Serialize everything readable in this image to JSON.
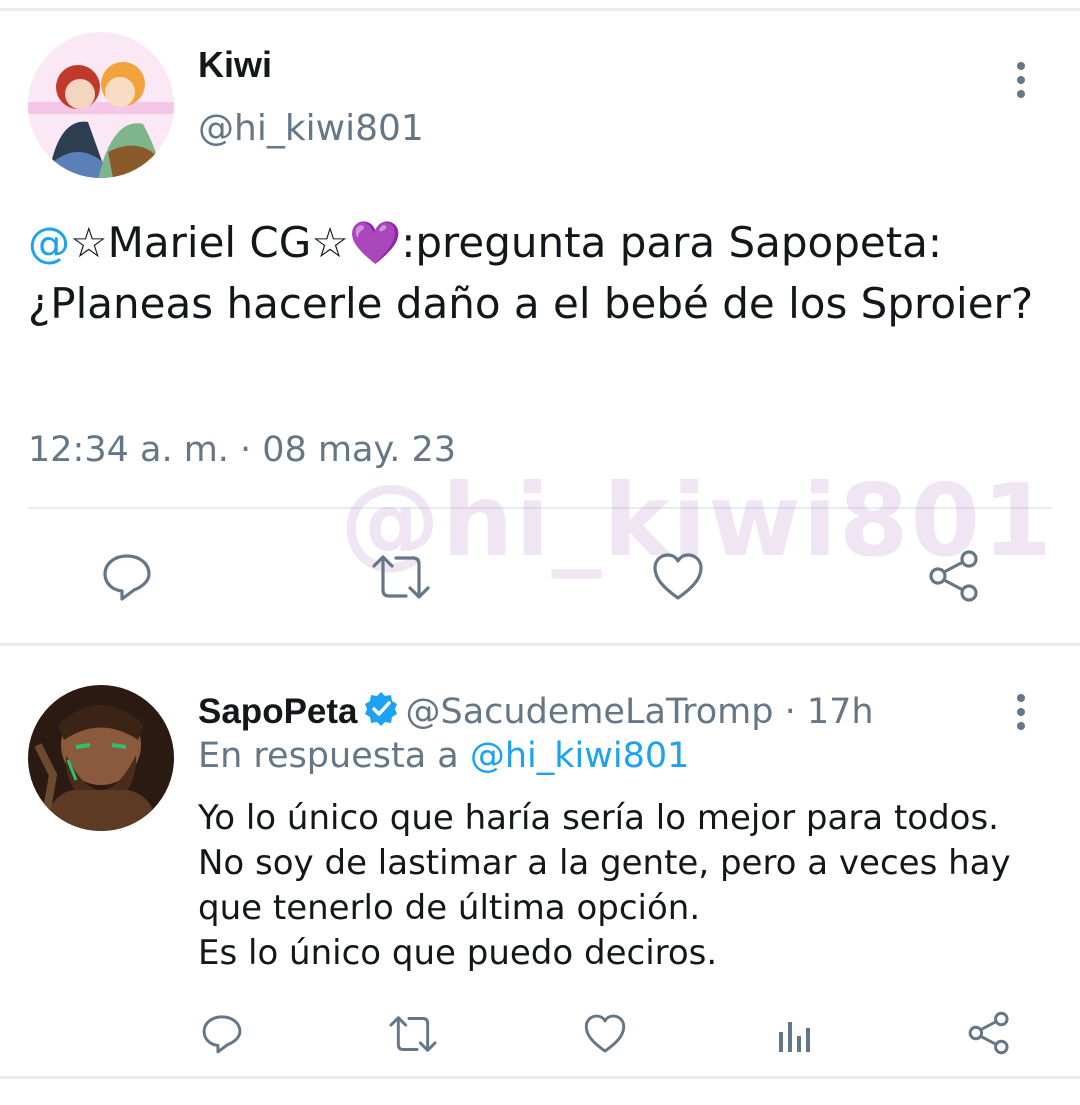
{
  "tweet": {
    "display_name": "Kiwi",
    "handle": "@hi_kiwi801",
    "text_mention": "@",
    "text_body": "☆Mariel CG☆💜:pregunta para Sapopeta: ¿Planeas hacerle daño a el bebé de los Sproier?",
    "timestamp": "12:34 a. m. · 08 may. 23",
    "watermark": "@hi_kiwi801"
  },
  "reply": {
    "display_name": "SapoPeta",
    "handle_time": "@SacudemeLaTromp · 17h",
    "replying_prefix": "En respuesta a ",
    "replying_handle": "@hi_kiwi801",
    "lines": [
      "Yo lo único que haría sería lo mejor para todos.",
      "No soy de lastimar a la gente, pero a veces hay",
      "que tenerlo de última opción.",
      "Es lo único que puedo deciros."
    ]
  },
  "icons": {
    "reply": "reply-icon",
    "retweet": "retweet-icon",
    "like": "heart-icon",
    "share": "share-icon",
    "analytics": "analytics-icon",
    "more": "more-vertical-icon",
    "verified": "verified-badge-icon"
  },
  "colors": {
    "accent": "#1da1f2",
    "muted": "#657786",
    "divider": "#e6ecf0"
  }
}
